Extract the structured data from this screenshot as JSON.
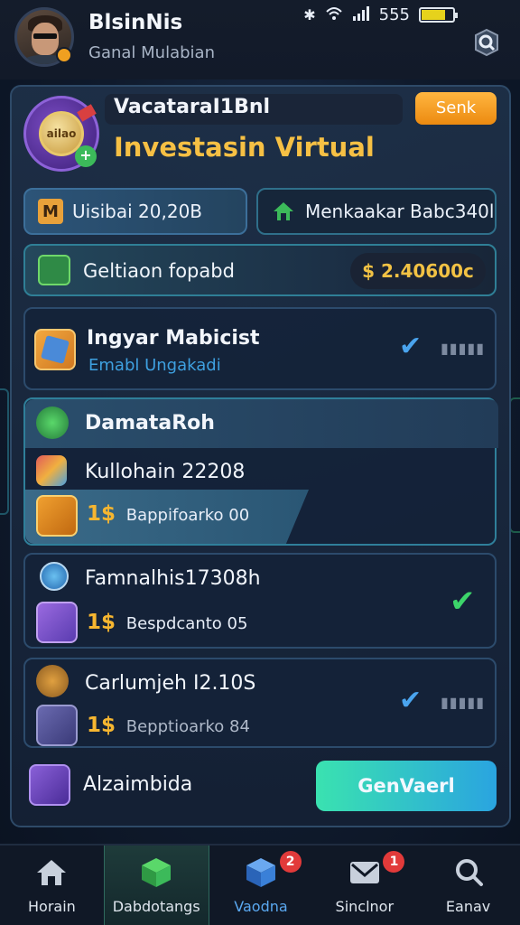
{
  "header": {
    "title": "BlsinNis",
    "subtitle": "Ganal Mulabian"
  },
  "status_bar": {
    "battery_text": "555"
  },
  "card": {
    "top_label": "VacataraI‌1Bnl",
    "top_button": "Senk",
    "headline": "Investasin Virtual",
    "coin_text": "ailao"
  },
  "stats": {
    "left": "Uisibai 20,20B",
    "right": "Menkaakar Bab‌c340l"
  },
  "balance": {
    "label": "Geltiaon fopabd",
    "amount": "$ 2.40600c"
  },
  "items": [
    {
      "title": "Ingyar Mabicist",
      "sub": "Emabl Ungakadi",
      "status": "check"
    },
    {
      "title": "DamataRoh",
      "sub_title": "Kullohain 22208",
      "price": "1$",
      "sub": "Bappifoarko 00",
      "status": "none"
    },
    {
      "title": "Famnalhis‌17308h",
      "price": "1$",
      "sub": "Bespdcanto 05",
      "status": "check-green"
    },
    {
      "title": "Carlumjeh I2.10S",
      "price": "1$",
      "sub": "Bepptioarko 84",
      "status": "check"
    }
  ],
  "footer_row": {
    "label": "Alzaimbida",
    "button": "GenVaerl"
  },
  "bottom_nav": [
    {
      "label": "Horain",
      "icon": "home-icon"
    },
    {
      "label": "Dabdotangs",
      "icon": "cube-stack-icon",
      "active": true
    },
    {
      "label": "Vaodna",
      "icon": "box-icon",
      "badge": "2"
    },
    {
      "label": "Sinclnor",
      "icon": "mail-icon",
      "badge": "1"
    },
    {
      "label": "Eanav",
      "icon": "search-icon"
    }
  ],
  "colors": {
    "accent_gold": "#f6c044",
    "accent_green": "#3cba5a",
    "badge_red": "#e23a3a",
    "button_orange": "#ec8a10",
    "button_gradient_start": "#3ae2b0"
  }
}
